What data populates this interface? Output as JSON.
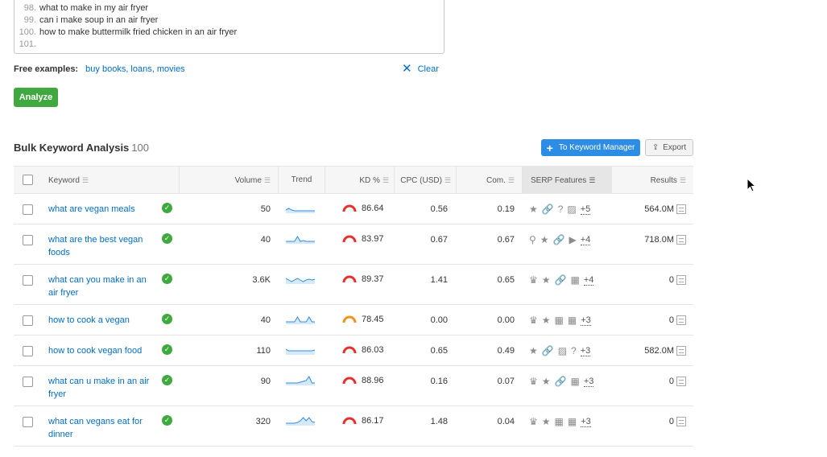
{
  "textarea": {
    "lines": [
      {
        "n": "98.",
        "text": "what to make in my air fryer"
      },
      {
        "n": "99.",
        "text": "can i make soup in an air fryer"
      },
      {
        "n": "100.",
        "text": "how to make buttermilk fried chicken in an air fryer"
      },
      {
        "n": "101.",
        "text": ""
      }
    ]
  },
  "examples": {
    "label": "Free examples:",
    "links": "buy books, loans, movies"
  },
  "clear_label": "Clear",
  "analyze_label": "Analyze",
  "section": {
    "title": "Bulk Keyword Analysis",
    "count": "100"
  },
  "buttons": {
    "keyword_manager": "To Keyword Manager",
    "export": "Export"
  },
  "columns": {
    "keyword": "Keyword",
    "volume": "Volume",
    "trend": "Trend",
    "kd": "KD %",
    "cpc": "CPC (USD)",
    "com": "Com.",
    "serp": "SERP Features",
    "results": "Results"
  },
  "rows": [
    {
      "keyword": "what are vegan meals",
      "volume": "50",
      "kd": "86.64",
      "kd_color": "#e8302e",
      "cpc": "0.56",
      "com": "0.19",
      "serp_icons": [
        "star",
        "link",
        "question",
        "image"
      ],
      "serp_more": "+5",
      "results": "564.0M",
      "trend": [
        4,
        6,
        4,
        3,
        3,
        3,
        3,
        3,
        3,
        3,
        3
      ]
    },
    {
      "keyword": "what are the best vegan foods",
      "volume": "40",
      "kd": "83.97",
      "kd_color": "#e8302e",
      "cpc": "0.67",
      "com": "0.67",
      "serp_icons": [
        "pin",
        "star",
        "link",
        "video"
      ],
      "serp_more": "+4",
      "results": "718.0M",
      "trend": [
        3,
        3,
        3,
        3,
        9,
        3,
        4,
        3,
        3,
        3,
        3
      ]
    },
    {
      "keyword": "what can you make in an air fryer",
      "volume": "3.6K",
      "kd": "89.37",
      "kd_color": "#e8302e",
      "cpc": "1.41",
      "com": "0.65",
      "serp_icons": [
        "crown",
        "star",
        "link",
        "grid"
      ],
      "serp_more": "+4",
      "results": "0",
      "trend": [
        7,
        5,
        3,
        5,
        7,
        5,
        3,
        5,
        6,
        5,
        6
      ]
    },
    {
      "keyword": "how to cook a vegan",
      "volume": "40",
      "kd": "78.45",
      "kd_color": "#f2921d",
      "cpc": "0.00",
      "com": "0.00",
      "serp_icons": [
        "crown",
        "star",
        "grid",
        "grid"
      ],
      "serp_more": "+3",
      "results": "0",
      "trend": [
        3,
        3,
        3,
        3,
        9,
        3,
        3,
        3,
        9,
        3,
        3
      ]
    },
    {
      "keyword": "how to cook vegan food",
      "volume": "110",
      "kd": "86.03",
      "kd_color": "#e8302e",
      "cpc": "0.65",
      "com": "0.49",
      "serp_icons": [
        "star",
        "link",
        "image",
        "question"
      ],
      "serp_more": "+3",
      "results": "582.0M",
      "trend": [
        7,
        5,
        5,
        5,
        5,
        5,
        5,
        5,
        5,
        5,
        6
      ]
    },
    {
      "keyword": "what can u make in an air fryer",
      "volume": "90",
      "kd": "88.96",
      "kd_color": "#e8302e",
      "cpc": "0.16",
      "com": "0.07",
      "serp_icons": [
        "crown",
        "star",
        "link",
        "grid"
      ],
      "serp_more": "+3",
      "results": "0",
      "trend": [
        3,
        3,
        3,
        3,
        3,
        4,
        5,
        6,
        11,
        3,
        3
      ]
    },
    {
      "keyword": "what can vegans eat for dinner",
      "volume": "320",
      "kd": "86.17",
      "kd_color": "#e8302e",
      "cpc": "1.48",
      "com": "0.04",
      "serp_icons": [
        "crown",
        "star",
        "grid",
        "grid"
      ],
      "serp_more": "+3",
      "results": "0",
      "trend": [
        3,
        3,
        3,
        3,
        4,
        6,
        10,
        6,
        10,
        5,
        4
      ]
    }
  ],
  "colors": {
    "accent": "#2d8ce3",
    "link": "#006dca",
    "analyze": "#3fa83f"
  }
}
